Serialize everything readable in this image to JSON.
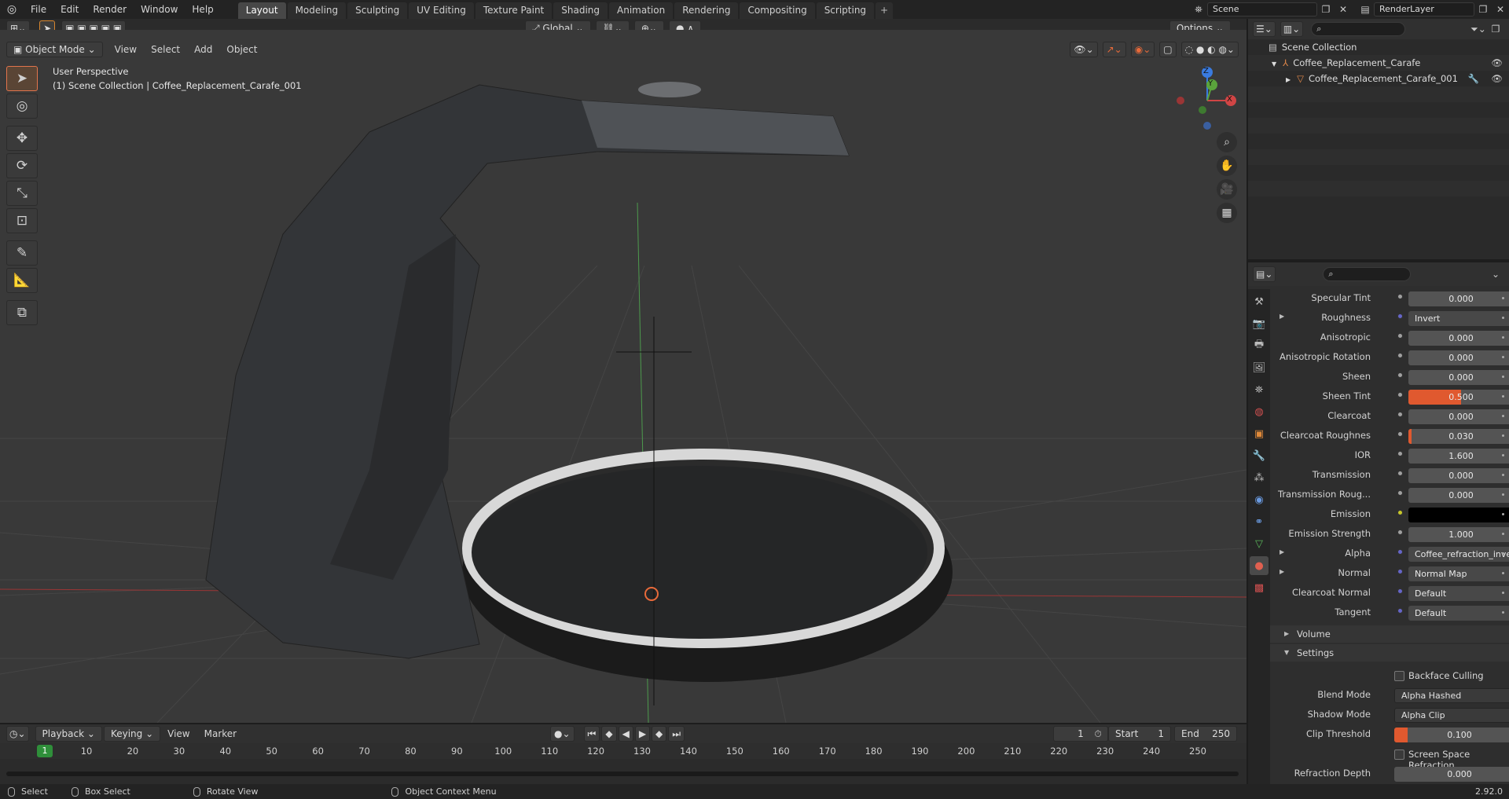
{
  "topbar": {
    "menus": [
      "File",
      "Edit",
      "Render",
      "Window",
      "Help"
    ],
    "workspaces": [
      "Layout",
      "Modeling",
      "Sculpting",
      "UV Editing",
      "Texture Paint",
      "Shading",
      "Animation",
      "Rendering",
      "Compositing",
      "Scripting"
    ],
    "active_workspace": "Layout",
    "scene": "Scene",
    "render_layer": "RenderLayer"
  },
  "viewport": {
    "mode": "Object Mode",
    "menus": [
      "View",
      "Select",
      "Add",
      "Object"
    ],
    "transform_orientation": "Global",
    "options_label": "Options",
    "perspective_text": "User Perspective",
    "collection_text": "(1) Scene Collection | Coffee_Replacement_Carafe_001",
    "gizmo": {
      "z": "Z",
      "y": "Y",
      "x": "X"
    }
  },
  "outliner": {
    "root": "Scene Collection",
    "items": [
      "Coffee_Replacement_Carafe",
      "Coffee_Replacement_Carafe_001"
    ]
  },
  "properties": {
    "rows": [
      {
        "label": "Specular Tint",
        "value": "0.000"
      },
      {
        "label": "Roughness",
        "value": "Invert"
      },
      {
        "label": "Anisotropic",
        "value": "0.000"
      },
      {
        "label": "Anisotropic Rotation",
        "value": "0.000"
      },
      {
        "label": "Sheen",
        "value": "0.000"
      },
      {
        "label": "Sheen Tint",
        "value": "0.500"
      },
      {
        "label": "Clearcoat",
        "value": "0.000"
      },
      {
        "label": "Clearcoat Roughnes",
        "value": "0.030"
      },
      {
        "label": "IOR",
        "value": "1.600"
      },
      {
        "label": "Transmission",
        "value": "0.000"
      },
      {
        "label": "Transmission Roug...",
        "value": "0.000"
      },
      {
        "label": "Emission",
        "value": ""
      },
      {
        "label": "Emission Strength",
        "value": "1.000"
      },
      {
        "label": "Alpha",
        "value": "Coffee_refraction_invert.p..."
      },
      {
        "label": "Normal",
        "value": "Normal Map"
      },
      {
        "label": "Clearcoat Normal",
        "value": "Default"
      },
      {
        "label": "Tangent",
        "value": "Default"
      }
    ],
    "sheen_tint_fraction": 0.5,
    "clearcoat_roughness_fraction": 0.03,
    "sections": {
      "volume": "Volume",
      "settings": "Settings"
    },
    "settings": {
      "backface_culling": "Backface Culling",
      "blend_mode_label": "Blend Mode",
      "blend_mode": "Alpha Hashed",
      "shadow_mode_label": "Shadow Mode",
      "shadow_mode": "Alpha Clip",
      "clip_threshold_label": "Clip Threshold",
      "clip_threshold": "0.100",
      "clip_threshold_fraction": 0.1,
      "ssr": "Screen Space Refraction",
      "refraction_depth_label": "Refraction Depth",
      "refraction_depth": "0.000"
    }
  },
  "timeline": {
    "menus": [
      "Playback",
      "Keying",
      "View",
      "Marker"
    ],
    "current_frame": "1",
    "start_label": "Start",
    "start": "1",
    "end_label": "End",
    "end": "250",
    "ticks": [
      "1",
      "10",
      "20",
      "30",
      "40",
      "50",
      "60",
      "70",
      "80",
      "90",
      "100",
      "110",
      "120",
      "130",
      "140",
      "150",
      "160",
      "170",
      "180",
      "190",
      "200",
      "210",
      "220",
      "230",
      "240",
      "250"
    ]
  },
  "statusbar": {
    "select": "Select",
    "box_select": "Box Select",
    "rotate_view": "Rotate View",
    "context_menu": "Object Context Menu",
    "version": "2.92.0"
  },
  "colors": {
    "accent": "#e0592f",
    "frame": "#2f8f3a",
    "active_tool": "#e2744c"
  }
}
